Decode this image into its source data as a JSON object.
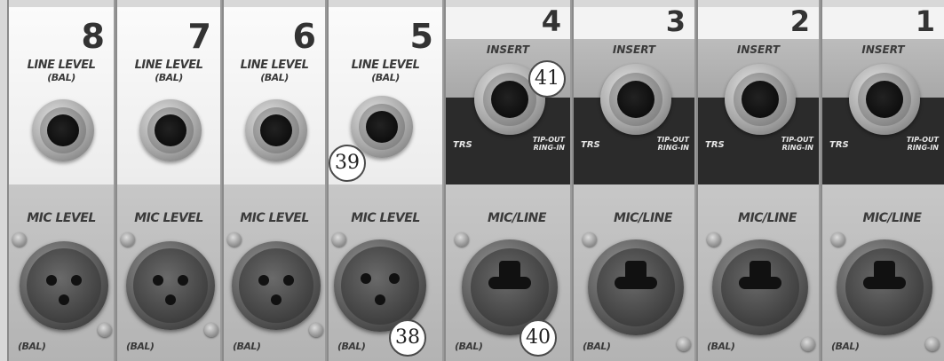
{
  "channels": [
    {
      "number": "8",
      "line_label": "LINE LEVEL",
      "line_sub": "(BAL)",
      "mic_label": "MIC LEVEL",
      "bal": "(BAL)"
    },
    {
      "number": "7",
      "line_label": "LINE LEVEL",
      "line_sub": "(BAL)",
      "mic_label": "MIC LEVEL",
      "bal": "(BAL)"
    },
    {
      "number": "6",
      "line_label": "LINE LEVEL",
      "line_sub": "(BAL)",
      "mic_label": "MIC LEVEL",
      "bal": "(BAL)"
    },
    {
      "number": "5",
      "line_label": "LINE LEVEL",
      "line_sub": "(BAL)",
      "mic_label": "MIC LEVEL",
      "bal": "(BAL)"
    },
    {
      "number": "4",
      "insert_label": "INSERT",
      "trs": "TRS",
      "tip_out": "TIP-OUT",
      "ring_in": "RING-IN",
      "mic_label": "MIC/LINE",
      "bal": "(BAL)"
    },
    {
      "number": "3",
      "insert_label": "INSERT",
      "trs": "TRS",
      "tip_out": "TIP-OUT",
      "ring_in": "RING-IN",
      "mic_label": "MIC/LINE",
      "bal": "(BAL)"
    },
    {
      "number": "2",
      "insert_label": "INSERT",
      "trs": "TRS",
      "tip_out": "TIP-OUT",
      "ring_in": "RING-IN",
      "mic_label": "MIC/LINE",
      "bal": "(BAL)"
    },
    {
      "number": "1",
      "insert_label": "INSERT",
      "trs": "TRS",
      "tip_out": "TIP-OUT",
      "ring_in": "RING-IN",
      "mic_label": "MIC/LINE",
      "bal": "(BAL)"
    }
  ],
  "callouts": {
    "insert_jack": "41",
    "line_jack": "39",
    "xlr_jack": "38",
    "combo_jack": "40"
  }
}
